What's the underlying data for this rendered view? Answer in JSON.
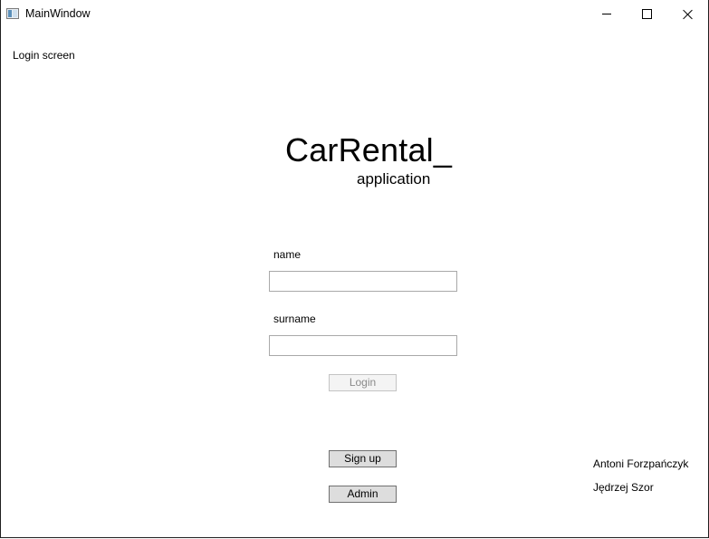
{
  "window": {
    "title": "MainWindow",
    "controls": {
      "minimize": "minimize",
      "maximize": "maximize",
      "close": "close"
    }
  },
  "screen_label": "Login screen",
  "brand": {
    "title": "CarRental_",
    "subtitle": "application"
  },
  "form": {
    "name_label": "name",
    "name_value": "",
    "surname_label": "surname",
    "surname_value": "",
    "login_label": "Login",
    "login_enabled": false
  },
  "actions": {
    "signup_label": "Sign up",
    "admin_label": "Admin"
  },
  "authors": [
    "Antoni Forzpańczyk",
    "Jędrzej Szor"
  ],
  "icons": {
    "app": "app-window-icon",
    "minimize": "minimize-icon",
    "maximize": "maximize-icon",
    "close": "close-icon"
  },
  "colors": {
    "background": "#ffffff",
    "button_face": "#dddddd",
    "button_border": "#707070",
    "disabled_text": "#8a8a8a",
    "input_border": "#a9a9a9"
  }
}
